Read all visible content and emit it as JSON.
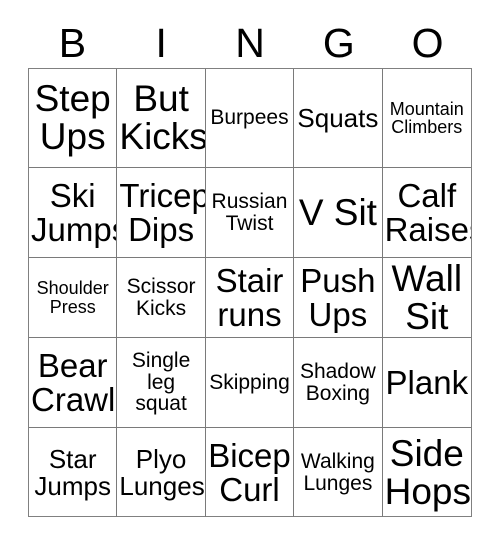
{
  "card": {
    "title": "BINGO",
    "header_letters": [
      "B",
      "I",
      "N",
      "G",
      "O"
    ],
    "text_color": "#000000",
    "border_color": "#7a7a7a",
    "background_color": "#ffffff",
    "rows": 5,
    "columns": 5,
    "cells": [
      {
        "text": "Step\nUps",
        "size": "s-xl"
      },
      {
        "text": "But\nKicks",
        "size": "s-xl"
      },
      {
        "text": "Burpees",
        "size": "s-sm"
      },
      {
        "text": "Squats",
        "size": "s-md"
      },
      {
        "text": "Mountain\nClimbers",
        "size": "s-xs"
      },
      {
        "text": "Ski\nJumps",
        "size": "s-lg"
      },
      {
        "text": "Tricep\nDips",
        "size": "s-lg"
      },
      {
        "text": "Russian\nTwist",
        "size": "s-sm"
      },
      {
        "text": "V Sit",
        "size": "s-xl"
      },
      {
        "text": "Calf\nRaises",
        "size": "s-lg"
      },
      {
        "text": "Shoulder\nPress",
        "size": "s-xs"
      },
      {
        "text": "Scissor\nKicks",
        "size": "s-sm"
      },
      {
        "text": "Stair\nruns",
        "size": "s-lg"
      },
      {
        "text": "Push\nUps",
        "size": "s-lg"
      },
      {
        "text": "Wall\nSit",
        "size": "s-xl"
      },
      {
        "text": "Bear\nCrawl",
        "size": "s-lg"
      },
      {
        "text": "Single\nleg\nsquat",
        "size": "s-sm"
      },
      {
        "text": "Skipping",
        "size": "s-sm"
      },
      {
        "text": "Shadow\nBoxing",
        "size": "s-sm"
      },
      {
        "text": "Plank",
        "size": "s-lg"
      },
      {
        "text": "Star\nJumps",
        "size": "s-md"
      },
      {
        "text": "Plyo\nLunges",
        "size": "s-md"
      },
      {
        "text": "Bicep\nCurl",
        "size": "s-lg"
      },
      {
        "text": "Walking\nLunges",
        "size": "s-sm"
      },
      {
        "text": "Side\nHops",
        "size": "s-xl"
      }
    ]
  }
}
